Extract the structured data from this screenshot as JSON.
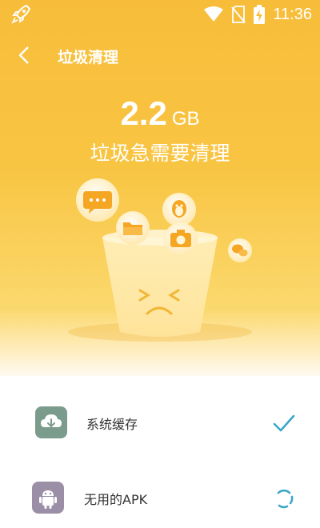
{
  "status_bar": {
    "time": "11:36"
  },
  "header": {
    "title": "垃圾清理"
  },
  "summary": {
    "size_value": "2.2",
    "size_unit": "GB",
    "subtitle": "垃圾急需要清理"
  },
  "items": [
    {
      "label": "系统缓存",
      "state": "done",
      "icon": "cloud-download-icon",
      "icon_color": "#7b9b8c"
    },
    {
      "label": "无用的APK",
      "state": "scanning",
      "icon": "android-icon",
      "icon_color": "#9a8fa6"
    }
  ],
  "colors": {
    "accent": "#f8c03e",
    "check": "#3aa6c9"
  }
}
